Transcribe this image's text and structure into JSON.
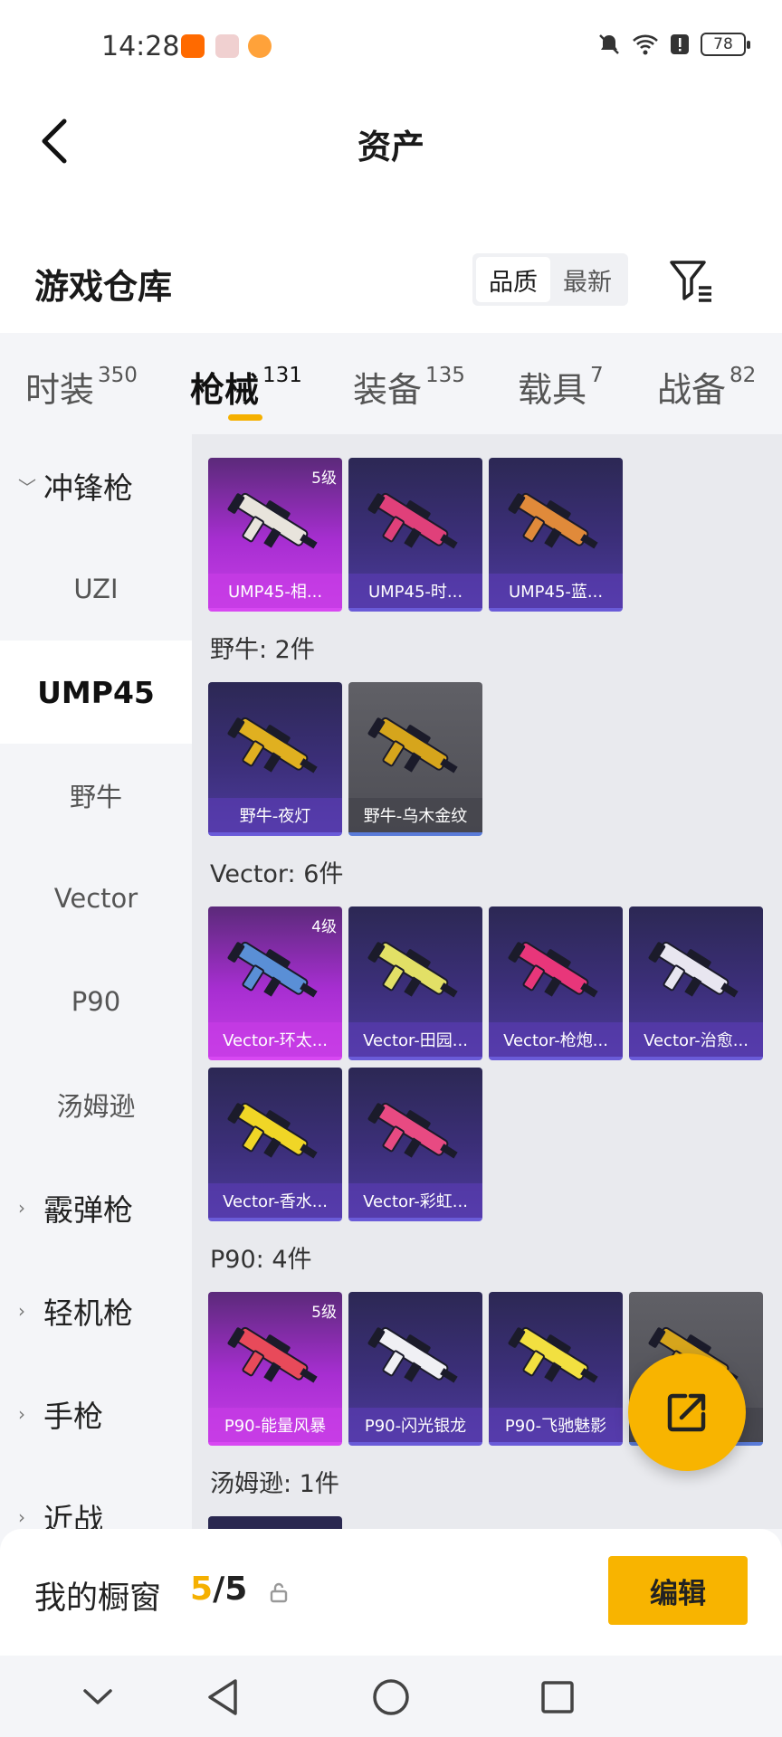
{
  "status_bar": {
    "time": "14:28",
    "battery": "78"
  },
  "header": {
    "title": "资产",
    "back_icon": "back-arrow-icon"
  },
  "subheader": {
    "title": "游戏仓库",
    "sort_options": [
      "品质",
      "最新"
    ],
    "sort_active": "品质",
    "filter_icon": "filter-icon"
  },
  "tabs": [
    {
      "label": "时装",
      "count": "350"
    },
    {
      "label": "枪械",
      "count": "131",
      "active": true
    },
    {
      "label": "装备",
      "count": "135"
    },
    {
      "label": "载具",
      "count": "7"
    },
    {
      "label": "战备",
      "count": "82"
    }
  ],
  "sidebar": {
    "items": [
      {
        "label": "冲锋枪",
        "type": "category",
        "expanded": true
      },
      {
        "label": "UZI",
        "type": "sub"
      },
      {
        "label": "UMP45",
        "type": "sub",
        "active": true
      },
      {
        "label": "野牛",
        "type": "sub"
      },
      {
        "label": "Vector",
        "type": "sub"
      },
      {
        "label": "P90",
        "type": "sub"
      },
      {
        "label": "汤姆逊",
        "type": "sub"
      },
      {
        "label": "霰弹枪",
        "type": "category"
      },
      {
        "label": "轻机枪",
        "type": "category"
      },
      {
        "label": "手枪",
        "type": "category"
      },
      {
        "label": "近战",
        "type": "category"
      }
    ]
  },
  "groups": [
    {
      "label": "",
      "cards": [
        {
          "name": "UMP45-相...",
          "level": "5级",
          "style": "pink",
          "gun_color": "#e8e4dc"
        },
        {
          "name": "UMP45-时...",
          "level": "",
          "style": "purple",
          "gun_color": "#e0407a"
        },
        {
          "name": "UMP45-蓝...",
          "level": "",
          "style": "purple",
          "gun_color": "#e08a3a"
        }
      ]
    },
    {
      "label": "野牛: 2件",
      "cards": [
        {
          "name": "野牛-夜灯",
          "level": "",
          "style": "purple",
          "gun_color": "#e0b020"
        },
        {
          "name": "野牛-乌木金纹",
          "level": "",
          "style": "gray",
          "gun_color": "#d6a51c"
        }
      ]
    },
    {
      "label": "Vector: 6件",
      "cards": [
        {
          "name": "Vector-环太...",
          "level": "4级",
          "style": "pink",
          "gun_color": "#5a8fd6"
        },
        {
          "name": "Vector-田园...",
          "level": "",
          "style": "purple",
          "gun_color": "#e2e066"
        },
        {
          "name": "Vector-枪炮...",
          "level": "",
          "style": "purple",
          "gun_color": "#e8367a"
        },
        {
          "name": "Vector-治愈...",
          "level": "",
          "style": "purple",
          "gun_color": "#e8e6f0"
        },
        {
          "name": "Vector-香水...",
          "level": "",
          "style": "purple",
          "gun_color": "#f0d626"
        },
        {
          "name": "Vector-彩虹...",
          "level": "",
          "style": "purple",
          "gun_color": "#e84a82"
        }
      ]
    },
    {
      "label": "P90: 4件",
      "cards": [
        {
          "name": "P90-能量风暴",
          "level": "5级",
          "style": "pink",
          "gun_color": "#e84a5a"
        },
        {
          "name": "P90-闪光银龙",
          "level": "",
          "style": "purple",
          "gun_color": "#f0f0f4"
        },
        {
          "name": "P90-飞驰魅影",
          "level": "",
          "style": "purple",
          "gun_color": "#f2e040"
        },
        {
          "name": "P90-...纹",
          "level": "",
          "style": "gray",
          "gun_color": "#d6a51c"
        }
      ]
    },
    {
      "label": "汤姆逊: 1件",
      "cards": []
    }
  ],
  "fab": {
    "icon": "share-export-icon"
  },
  "bottom": {
    "showcase_label": "我的橱窗",
    "showcase_current": "5",
    "showcase_total": "/5",
    "edit_label": "编辑"
  },
  "colors": {
    "accent": "#f8b400",
    "purple_card": "#3c2f7a",
    "pink_card": "#a72ed1"
  }
}
